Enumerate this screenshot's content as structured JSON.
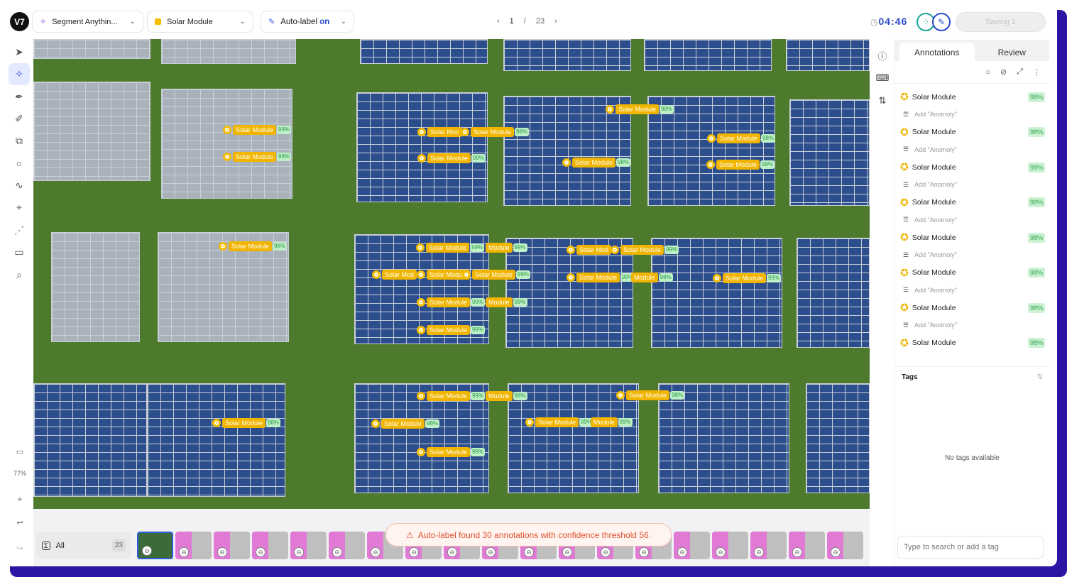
{
  "header": {
    "logo": "V7",
    "model": "Segment Anythin...",
    "class_name": "Solar Module",
    "class_color": "#f5bd00",
    "autolabel_label": "Auto-label",
    "autolabel_state": "on",
    "page_current": "1",
    "page_sep": "/",
    "page_total": "23",
    "timer": "04:46",
    "saving": "Saving 1"
  },
  "toolbar": {
    "tools": [
      "cursor-icon",
      "segment-anything-icon",
      "pen-icon",
      "brush-icon",
      "polygon-icon",
      "ellipse-icon",
      "polyline-icon",
      "keypoint-icon",
      "skeleton-icon",
      "comment-icon",
      "zoom-icon"
    ],
    "zoom_level": "77%"
  },
  "canvas": {
    "annotations": [
      {
        "label": "Solar Module",
        "confidence": "99%"
      },
      {
        "label": "Solar Module",
        "confidence": "98%"
      },
      {
        "label": "Solar Moc",
        "confidence": ""
      },
      {
        "label": "Solar Module",
        "confidence": "98%"
      },
      {
        "label": "Solar Module",
        "confidence": "99%"
      },
      {
        "label": "Solar Module",
        "confidence": "98%"
      },
      {
        "label": "Solar Module",
        "confidence": "98%"
      },
      {
        "label": "Solar Module",
        "confidence": "99%"
      },
      {
        "label": "Solar Module",
        "confidence": "98%"
      },
      {
        "label": "Solar Module",
        "confidence": "98%"
      },
      {
        "label": "Solar Module",
        "confidence": "99%"
      },
      {
        "label": "Module",
        "confidence": "99%"
      },
      {
        "label": "Solar Mod",
        "confidence": ""
      },
      {
        "label": "Solar Module",
        "confidence": "99%"
      },
      {
        "label": "Solar Mod",
        "confidence": ""
      },
      {
        "label": "Solar Module",
        "confidence": ""
      },
      {
        "label": "Solar Module",
        "confidence": "99%"
      },
      {
        "label": "Solar Module",
        "confidence": "99%"
      },
      {
        "label": "Module",
        "confidence": "98%"
      },
      {
        "label": "Solar Module",
        "confidence": "99%"
      },
      {
        "label": "Solar Module",
        "confidence": "99%"
      },
      {
        "label": "Module",
        "confidence": "99%"
      },
      {
        "label": "Solar Module",
        "confidence": "99%"
      },
      {
        "label": "Solar Module",
        "confidence": "99%"
      },
      {
        "label": "Module",
        "confidence": "98%"
      },
      {
        "label": "Solar Module",
        "confidence": "98%"
      },
      {
        "label": "Solar Module",
        "confidence": "98%"
      },
      {
        "label": "Solar Module",
        "confidence": "98%"
      },
      {
        "label": "Solar Module",
        "confidence": "99%"
      },
      {
        "label": "Module",
        "confidence": "99%"
      },
      {
        "label": "Solar Module",
        "confidence": "98%"
      }
    ]
  },
  "filmstrip": {
    "all_label": "All",
    "count": "23",
    "toast": "Auto-label found 30 annotations with confidence threshold 56."
  },
  "panel": {
    "tabs": [
      "Annotations",
      "Review"
    ],
    "items": [
      {
        "name": "Solar Module",
        "confidence": "98%",
        "attr": "Add \"Anomoly\""
      },
      {
        "name": "Solar Module",
        "confidence": "98%",
        "attr": "Add \"Anomoly\""
      },
      {
        "name": "Solar Module",
        "confidence": "98%",
        "attr": "Add \"Anomoly\""
      },
      {
        "name": "Solar Module",
        "confidence": "98%",
        "attr": "Add \"Anomoly\""
      },
      {
        "name": "Solar Module",
        "confidence": "98%",
        "attr": "Add \"Anomoly\""
      },
      {
        "name": "Solar Module",
        "confidence": "98%",
        "attr": "Add \"Anomoly\""
      },
      {
        "name": "Solar Module",
        "confidence": "98%",
        "attr": "Add \"Anomoly\""
      },
      {
        "name": "Solar Module",
        "confidence": "98%",
        "attr": ""
      }
    ],
    "tags_title": "Tags",
    "no_tags": "No tags available",
    "tag_placeholder": "Type to search or add a tag"
  }
}
